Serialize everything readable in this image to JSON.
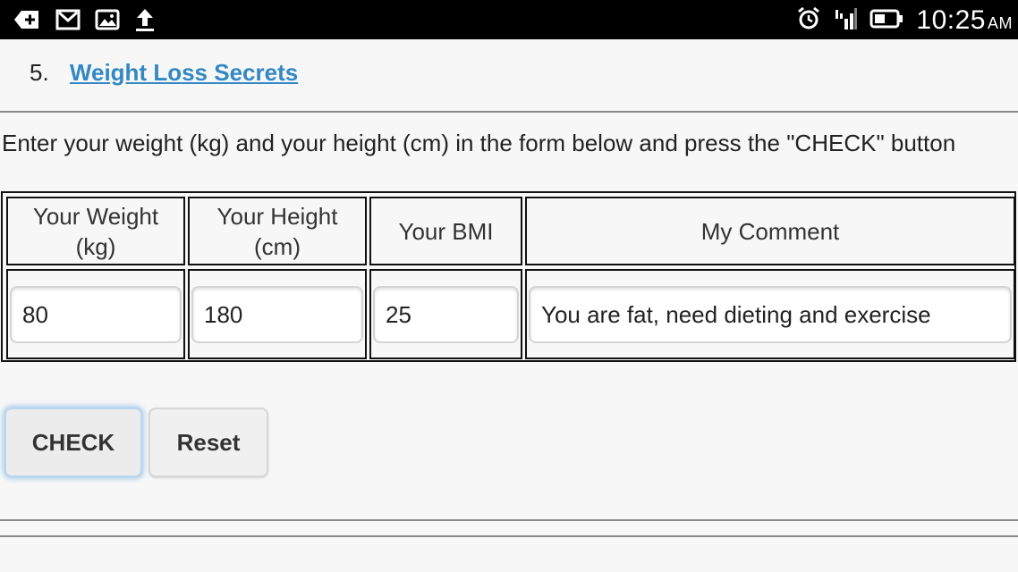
{
  "status_bar": {
    "time": "10:25",
    "ampm": "AM",
    "left_icons": [
      "add-notification-icon",
      "gmail-icon",
      "image-icon",
      "upload-icon"
    ],
    "right_icons": [
      "alarm-icon",
      "signal-icon",
      "battery-icon"
    ]
  },
  "list": {
    "number": "5.",
    "link_text": "Weight Loss Secrets"
  },
  "instructions": "Enter your weight (kg) and your height (cm) in the form below and press the \"CHECK\" button",
  "table": {
    "headers": [
      "Your Weight (kg)",
      "Your Height (cm)",
      "Your BMI",
      "My Comment"
    ],
    "values": {
      "weight": "80",
      "height": "180",
      "bmi": "25",
      "comment": "You are fat, need dieting and exercise"
    }
  },
  "buttons": {
    "check": "CHECK",
    "reset": "Reset"
  },
  "colors": {
    "link": "#3388c4",
    "status_bar": "#000000",
    "background": "#f7f7f7"
  }
}
